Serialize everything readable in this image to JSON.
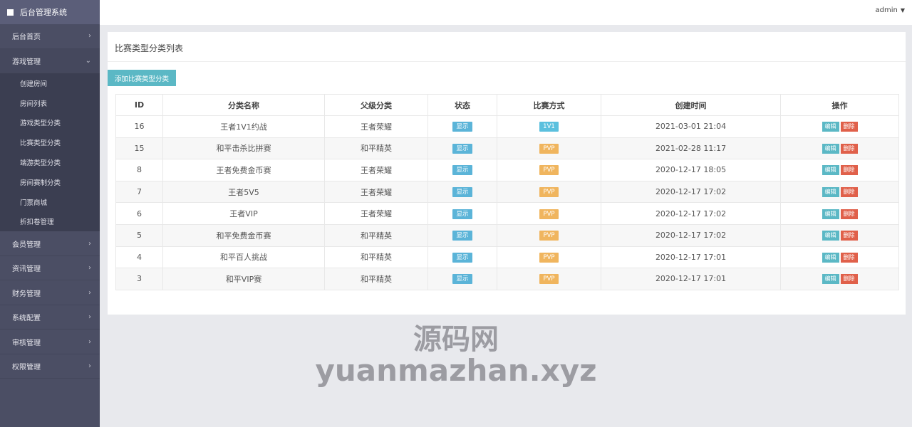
{
  "app": {
    "title": "后台管理系统",
    "user": "admin"
  },
  "sidebar": {
    "items": [
      {
        "label": "后台首页",
        "chevron": "›"
      },
      {
        "label": "游戏管理",
        "chevron": "⌄"
      },
      {
        "label": "会员管理",
        "chevron": "›"
      },
      {
        "label": "资讯管理",
        "chevron": "›"
      },
      {
        "label": "财务管理",
        "chevron": "›"
      },
      {
        "label": "系统配置",
        "chevron": "›"
      },
      {
        "label": "审核管理",
        "chevron": "›"
      },
      {
        "label": "权限管理",
        "chevron": "›"
      }
    ],
    "sub_items": [
      "创建房间",
      "房间列表",
      "游戏类型分类",
      "比赛类型分类",
      "端游类型分类",
      "房间赛制分类",
      "门票商城",
      "折扣卷管理"
    ]
  },
  "panel": {
    "title": "比赛类型分类列表",
    "add_button": "添加比赛类型分类"
  },
  "table": {
    "headers": [
      "ID",
      "分类名称",
      "父级分类",
      "状态",
      "比赛方式",
      "创建时间",
      "操作"
    ],
    "edit_label": "编辑",
    "delete_label": "删除",
    "rows": [
      {
        "id": "16",
        "name": "王者1V1约战",
        "parent": "王者荣耀",
        "status": "显示",
        "mode": "1V1",
        "created": "2021-03-01 21:04"
      },
      {
        "id": "15",
        "name": "和平击杀比拼赛",
        "parent": "和平精英",
        "status": "显示",
        "mode": "PVP",
        "created": "2021-02-28 11:17"
      },
      {
        "id": "8",
        "name": "王者免费金币赛",
        "parent": "王者荣耀",
        "status": "显示",
        "mode": "PVP",
        "created": "2020-12-17 18:05"
      },
      {
        "id": "7",
        "name": "王者5V5",
        "parent": "王者荣耀",
        "status": "显示",
        "mode": "PVP",
        "created": "2020-12-17 17:02"
      },
      {
        "id": "6",
        "name": "王者VIP",
        "parent": "王者荣耀",
        "status": "显示",
        "mode": "PVP",
        "created": "2020-12-17 17:02"
      },
      {
        "id": "5",
        "name": "和平免费金币赛",
        "parent": "和平精英",
        "status": "显示",
        "mode": "PVP",
        "created": "2020-12-17 17:02"
      },
      {
        "id": "4",
        "name": "和平百人挑战",
        "parent": "和平精英",
        "status": "显示",
        "mode": "PVP",
        "created": "2020-12-17 17:01"
      },
      {
        "id": "3",
        "name": "和平VIP赛",
        "parent": "和平精英",
        "status": "显示",
        "mode": "PVP",
        "created": "2020-12-17 17:01"
      }
    ]
  },
  "watermark": {
    "line1": "源码网",
    "line2": "yuanmazhan.xyz"
  },
  "colors": {
    "sidebar": "#4b4e64",
    "accent": "#5bb8c5",
    "danger": "#e0604a",
    "pvp": "#f0b55e"
  }
}
